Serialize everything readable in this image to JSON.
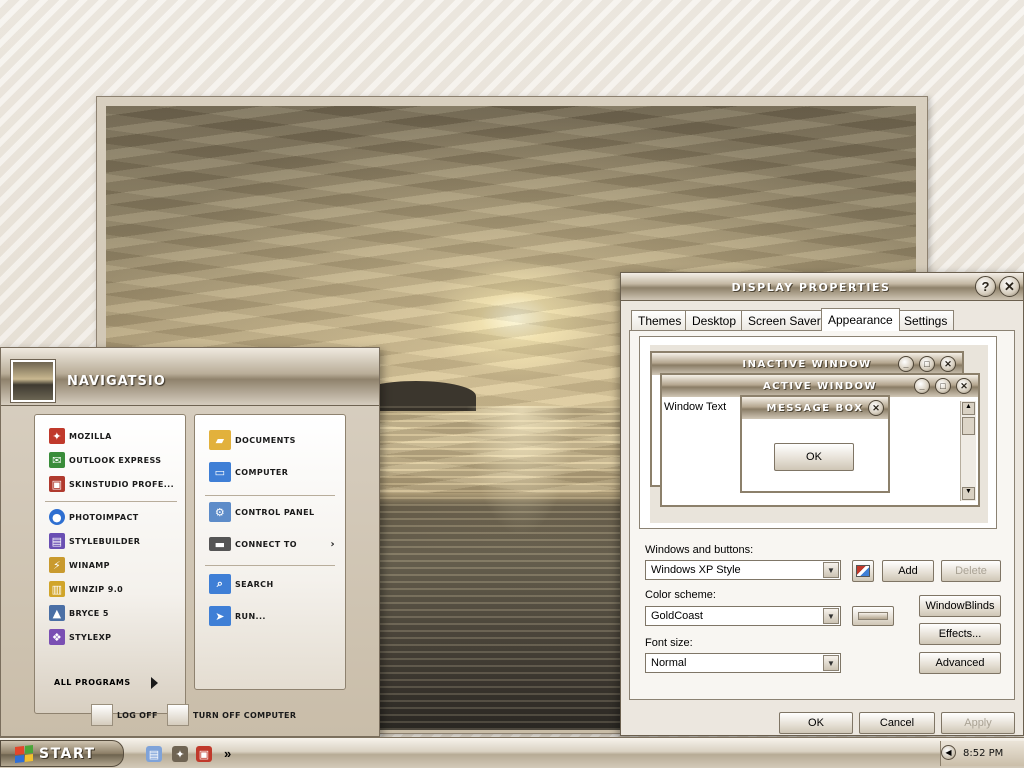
{
  "start_menu": {
    "username": "NAVIGATSIO",
    "pinned": [
      {
        "label": "MOZILLA",
        "icon": "mozilla-icon",
        "color": "#c0392b"
      },
      {
        "label": "OUTLOOK EXPRESS",
        "icon": "outlook-express-icon",
        "color": "#3a8d3a"
      },
      {
        "label": "SKINSTUDIO PROFE...",
        "icon": "skinstudio-icon",
        "color": "#b03a2e"
      }
    ],
    "recent": [
      {
        "label": "PHOTOIMPACT",
        "icon": "photoimpact-icon",
        "color": "#2e6fd1"
      },
      {
        "label": "STYLEBUILDER",
        "icon": "stylebuilder-icon",
        "color": "#6a4fb3"
      },
      {
        "label": "WINAMP",
        "icon": "winamp-icon",
        "color": "#c99a2e"
      },
      {
        "label": "WINZIP 9.0",
        "icon": "winzip-icon",
        "color": "#d1a52a"
      },
      {
        "label": "BRYCE 5",
        "icon": "bryce-icon",
        "color": "#4a6fa5"
      },
      {
        "label": "STYLEXP",
        "icon": "stylexp-icon",
        "color": "#7a4fb3"
      }
    ],
    "places": [
      {
        "label": "DOCUMENTS",
        "icon": "documents-icon",
        "color": "#e2b13c"
      },
      {
        "label": "COMPUTER",
        "icon": "computer-icon",
        "color": "#3f7fd6"
      },
      {
        "label": "CONTROL PANEL",
        "icon": "control-panel-icon",
        "color": "#5d8cc9"
      },
      {
        "label": "CONNECT TO",
        "icon": "connect-to-icon",
        "color": "#555555"
      },
      {
        "label": "SEARCH",
        "icon": "search-icon",
        "color": "#3f7fd6"
      },
      {
        "label": "RUN...",
        "icon": "run-icon",
        "color": "#3f7fd6"
      }
    ],
    "connect_arrow": "›",
    "all_programs": "ALL PROGRAMS",
    "log_off": "LOG OFF",
    "turn_off": "TURN OFF COMPUTER"
  },
  "dialog": {
    "title": "DISPLAY PROPERTIES",
    "help_glyph": "?",
    "close_glyph": "✕",
    "tabs": [
      "Themes",
      "Desktop",
      "Screen Saver",
      "Appearance",
      "Settings"
    ],
    "active_tab": "Appearance",
    "preview": {
      "inactive_title": "INACTIVE WINDOW",
      "active_title": "ACTIVE WINDOW",
      "message_title": "MESSAGE BOX",
      "window_text": "Window Text",
      "ok_label": "OK"
    },
    "windows_buttons_label": "Windows and buttons:",
    "windows_buttons_value": "Windows XP Style",
    "add_label": "Add",
    "delete_label": "Delete",
    "color_scheme_label": "Color scheme:",
    "color_scheme_value": "GoldCoast",
    "windowblinds_label": "WindowBlinds",
    "font_size_label": "Font size:",
    "font_size_value": "Normal",
    "effects_label": "Effects...",
    "advanced_label": "Advanced",
    "ok_label": "OK",
    "cancel_label": "Cancel",
    "apply_label": "Apply"
  },
  "taskbar": {
    "start_label": "START",
    "overflow": "»",
    "clock": "8:52 PM",
    "tray_arrow": "◀"
  }
}
